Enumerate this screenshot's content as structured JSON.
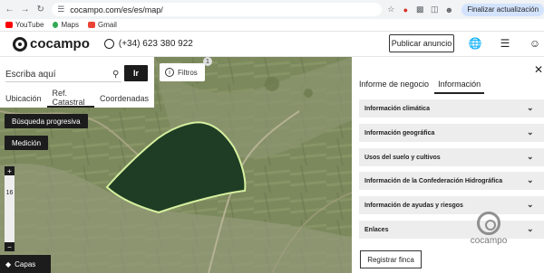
{
  "browser": {
    "url": "cocampo.com/es/es/map/",
    "update_label": "Finalizar actualización",
    "bookmarks": [
      "YouTube",
      "Maps",
      "Gmail"
    ]
  },
  "header": {
    "logo": "cocampo",
    "phone": "(+34) 623 380 922",
    "publish_label": "Publicar anuncio"
  },
  "search": {
    "placeholder": "Escriba aquí",
    "go_label": "Ir",
    "tabs": [
      "Ubicación",
      "Ref. Catastral",
      "Coordenadas"
    ],
    "active_tab": "Ref. Catastral"
  },
  "map": {
    "filter_label": "Filtros",
    "filter_count": "1",
    "progressive_search_label": "Búsqueda progresiva",
    "measure_label": "Medición",
    "zoom_level": "16",
    "layers_label": "Capas"
  },
  "info": {
    "tabs": [
      "Informe de negocio",
      "Información"
    ],
    "active_tab": "Información",
    "sections": [
      "Información climática",
      "Información geográfica",
      "Usos del suelo y cultivos",
      "Información de la Confederación Hidrográfica",
      "Información de ayudas y riesgos",
      "Enlaces"
    ],
    "register_label": "Registrar finca",
    "watermark": "cocampo"
  },
  "colors": {
    "primary_dark": "#1c1c1c",
    "accordion_bg": "#ededed",
    "parcel_fill": "#1f3d24",
    "parcel_border": "#d6f0a0"
  }
}
